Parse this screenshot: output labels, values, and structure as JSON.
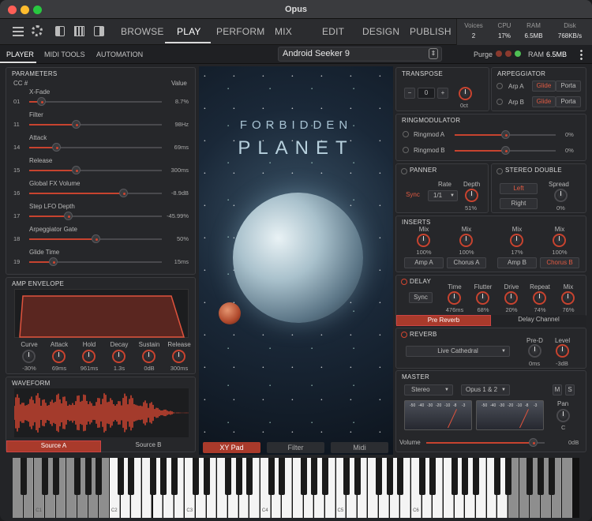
{
  "app": {
    "title": "Opus"
  },
  "nav": {
    "tabs": [
      "BROWSE",
      "PLAY",
      "PERFORM",
      "MIX",
      "EDIT",
      "DESIGN",
      "PUBLISH"
    ],
    "active": "PLAY"
  },
  "stats": [
    {
      "label": "Voices",
      "value": "2"
    },
    {
      "label": "CPU",
      "value": "17%"
    },
    {
      "label": "RAM",
      "value": "6.5MB"
    },
    {
      "label": "Disk",
      "value": "768KB/s"
    }
  ],
  "subnav": {
    "tabs": [
      "PLAYER",
      "MIDI TOOLS",
      "AUTOMATION"
    ],
    "active": "PLAYER"
  },
  "preset": {
    "name": "Android Seeker 9"
  },
  "purge": {
    "label": "Purge",
    "ram_label": "RAM",
    "ram_value": "6.5MB"
  },
  "parameters": {
    "title": "PARAMETERS",
    "cc_header": "CC #",
    "value_header": "Value",
    "rows": [
      {
        "cc": "01",
        "name": "X-Fade",
        "value": "8.7%",
        "level": 0.087
      },
      {
        "cc": "11",
        "name": "Filter",
        "value": "98Hz",
        "level": 0.35
      },
      {
        "cc": "14",
        "name": "Attack",
        "value": "69ms",
        "level": 0.2
      },
      {
        "cc": "15",
        "name": "Release",
        "value": "300ms",
        "level": 0.35
      },
      {
        "cc": "16",
        "name": "Global FX Volume",
        "value": "-8.9dB",
        "level": 0.71
      },
      {
        "cc": "17",
        "name": "Step LFO Depth",
        "value": "-45.99%",
        "level": 0.29
      },
      {
        "cc": "18",
        "name": "Arpeggiator Gate",
        "value": "50%",
        "level": 0.5
      },
      {
        "cc": "19",
        "name": "Glide Time",
        "value": "15ms",
        "level": 0.18
      }
    ]
  },
  "amp_envelope": {
    "title": "AMP ENVELOPE",
    "knobs": [
      {
        "label": "Curve",
        "value": "-30%"
      },
      {
        "label": "Attack",
        "value": "69ms"
      },
      {
        "label": "Hold",
        "value": "961ms"
      },
      {
        "label": "Decay",
        "value": "1.3s"
      },
      {
        "label": "Sustain",
        "value": "0dB"
      },
      {
        "label": "Release",
        "value": "300ms"
      }
    ]
  },
  "waveform": {
    "title": "WAVEFORM",
    "tabs": [
      "Source A",
      "Source B"
    ],
    "active": "Source A"
  },
  "center": {
    "title_line1": "FORBIDDEN",
    "title_line2": "PLANET",
    "tabs": [
      "XY Pad",
      "Filter",
      "Midi"
    ],
    "active": "XY Pad"
  },
  "transpose": {
    "title": "TRANSPOSE",
    "minus": "−",
    "value": "0",
    "plus": "+",
    "knob_value": "0ct"
  },
  "arpeggiator": {
    "title": "ARPEGGIATOR",
    "rows": [
      {
        "label": "Arp A",
        "glide": "Glide",
        "porta": "Porta"
      },
      {
        "label": "Arp B",
        "glide": "Glide",
        "porta": "Porta"
      }
    ]
  },
  "ringmod": {
    "title": "RINGMODULATOR",
    "rows": [
      {
        "label": "Ringmod A",
        "value": "0%"
      },
      {
        "label": "Ringmod B",
        "value": "0%"
      }
    ]
  },
  "panner": {
    "title": "PANNER",
    "rate_label": "Rate",
    "depth_label": "Depth",
    "sync": "Sync",
    "rate_value": "1/1",
    "depth_value": "51%"
  },
  "stereo_double": {
    "title": "STEREO DOUBLE",
    "left": "Left",
    "right": "Right",
    "spread_label": "Spread",
    "spread_value": "0%"
  },
  "inserts": {
    "title": "INSERTS",
    "knobs": [
      {
        "label": "Mix",
        "value": "100%",
        "slot": "Amp A"
      },
      {
        "label": "Mix",
        "value": "100%",
        "slot": "Chorus A"
      },
      {
        "label": "Mix",
        "value": "17%",
        "slot": "Amp B"
      },
      {
        "label": "Mix",
        "value": "100%",
        "slot": "Chorus B"
      }
    ]
  },
  "delay": {
    "title": "DELAY",
    "sync": "Sync",
    "knobs": [
      {
        "label": "Time",
        "value": "476ms"
      },
      {
        "label": "Flutter",
        "value": "68%"
      },
      {
        "label": "Drive",
        "value": "20%"
      },
      {
        "label": "Repeat",
        "value": "74%"
      },
      {
        "label": "Mix",
        "value": "76%"
      }
    ],
    "tabs": [
      "Pre Reverb",
      "Delay Channel"
    ],
    "active": "Pre Reverb"
  },
  "reverb": {
    "title": "REVERB",
    "preset": "Live Cathedral",
    "knobs": [
      {
        "label": "Pre-D",
        "value": "0ms"
      },
      {
        "label": "Level",
        "value": "-3dB"
      }
    ]
  },
  "master": {
    "title": "MASTER",
    "mode": "Stereo",
    "output": "Opus 1 & 2",
    "m": "M",
    "s": "S",
    "pan_label": "Pan",
    "pan_value": "C",
    "volume_label": "Volume",
    "volume_value": "0dB",
    "volume_level": 0.9,
    "vu_ticks": [
      "-50",
      "-40",
      "-30",
      "-20",
      "-10",
      "-8",
      "-3"
    ]
  },
  "keyboard": {
    "octaves": [
      "C1",
      "C2",
      "C3",
      "C4",
      "C5",
      "C6"
    ]
  }
}
